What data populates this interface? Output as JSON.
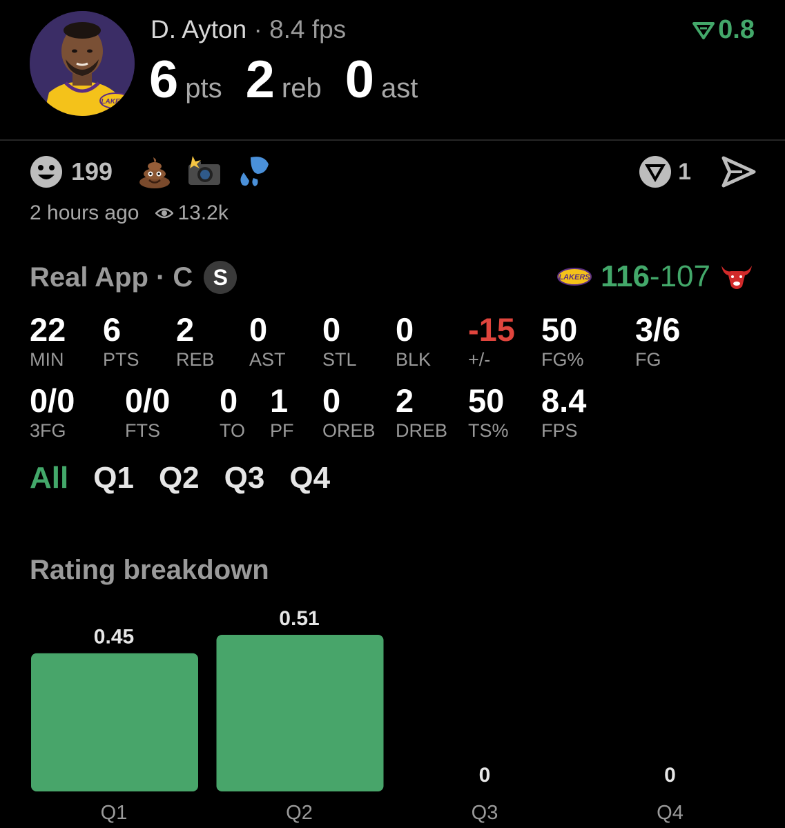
{
  "header": {
    "player_name": "D. Ayton",
    "separator": "·",
    "fps": "8.4 fps",
    "rating": "0.8",
    "rating_color": "#43a86a",
    "big_stats": [
      {
        "value": "6",
        "unit": "pts"
      },
      {
        "value": "2",
        "unit": "reb"
      },
      {
        "value": "0",
        "unit": "ast"
      }
    ],
    "team_logo_text": "LAKERS"
  },
  "reactions": {
    "smile_count": "199",
    "emojis": [
      "poop-icon",
      "camera-flash-icon",
      "sweat-drops-icon"
    ],
    "share_count": "1",
    "time_ago": "2 hours ago",
    "views": "13.2k"
  },
  "game": {
    "source": "Real App · C",
    "badge": "S",
    "home_score": "116",
    "dash": "-",
    "away_score": "107",
    "home_logo_text": "LAKERS"
  },
  "stats": {
    "row1": [
      {
        "value": "22",
        "label": "MIN"
      },
      {
        "value": "6",
        "label": "PTS"
      },
      {
        "value": "2",
        "label": "REB"
      },
      {
        "value": "0",
        "label": "AST"
      },
      {
        "value": "0",
        "label": "STL"
      },
      {
        "value": "0",
        "label": "BLK"
      },
      {
        "value": "-15",
        "label": "+/-"
      },
      {
        "value": "50",
        "label": "FG%"
      },
      {
        "value": "3/6",
        "label": "FG"
      }
    ],
    "row2": [
      {
        "value": "0/0",
        "label": "3FG"
      },
      {
        "value": "0/0",
        "label": "FTS"
      },
      {
        "value": "0",
        "label": "TO"
      },
      {
        "value": "1",
        "label": "PF"
      },
      {
        "value": "0",
        "label": "OREB"
      },
      {
        "value": "2",
        "label": "DREB"
      },
      {
        "value": "50",
        "label": "TS%"
      },
      {
        "value": "8.4",
        "label": "FPS"
      }
    ]
  },
  "tabs": [
    "All",
    "Q1",
    "Q2",
    "Q3",
    "Q4"
  ],
  "active_tab": "All",
  "chart_title": "Rating breakdown",
  "chart_data": {
    "type": "bar",
    "title": "Rating breakdown",
    "categories": [
      "Q1",
      "Q2",
      "Q3",
      "Q4"
    ],
    "values": [
      0.45,
      0.51,
      0,
      0
    ],
    "value_labels": [
      "0.45",
      "0.51",
      "0",
      "0"
    ],
    "ylim": [
      0,
      0.51
    ],
    "grid": false,
    "bar_color": "#48a56a"
  }
}
